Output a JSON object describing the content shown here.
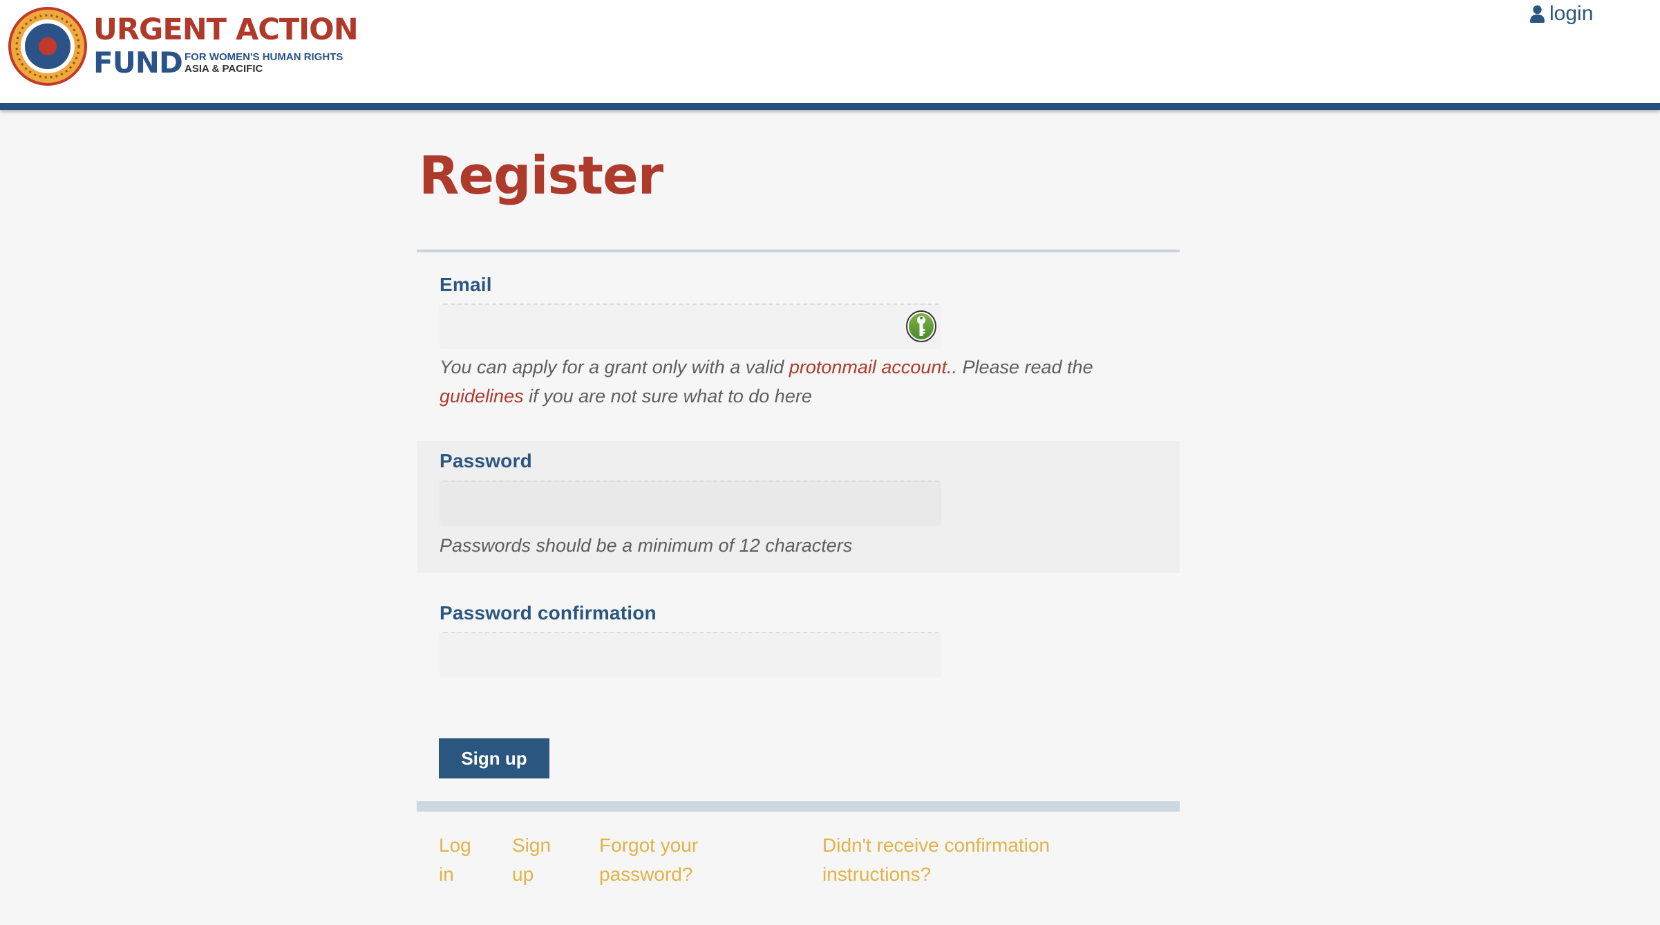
{
  "header": {
    "logo": {
      "line1": "URGENT ACTION",
      "line2": "FUND",
      "sub1": "FOR WOMEN'S HUMAN RIGHTS",
      "sub2": "ASIA & PACIFIC"
    },
    "login_label": "login",
    "login_icon": "user-icon"
  },
  "colors": {
    "brand_blue": "#24527f",
    "title_red": "#ad3a2b",
    "footer_link_gold": "#e1b349",
    "button_bg": "#2a5680"
  },
  "page": {
    "title": "Register"
  },
  "form": {
    "email": {
      "label": "Email",
      "value": "",
      "placeholder": "",
      "hint_prefix": "You can apply for a grant only with a valid ",
      "hint_link1": "protonmail account.",
      "hint_middle": ". Please read the ",
      "hint_link2": "guidelines",
      "hint_suffix": " if you are not sure what to do here",
      "icon": "password-manager-key-icon"
    },
    "password": {
      "label": "Password",
      "value": "",
      "placeholder": "",
      "hint": "Passwords should be a minimum of 12 characters"
    },
    "password_confirmation": {
      "label": "Password confirmation",
      "value": "",
      "placeholder": ""
    },
    "submit_label": "Sign up"
  },
  "footer": {
    "links": [
      {
        "line1": "Log",
        "line2": "in"
      },
      {
        "line1": "Sign",
        "line2": "up"
      },
      {
        "line1": "Forgot your",
        "line2": "password?"
      },
      {
        "line1": "Didn't receive confirmation",
        "line2": "instructions?"
      }
    ]
  }
}
